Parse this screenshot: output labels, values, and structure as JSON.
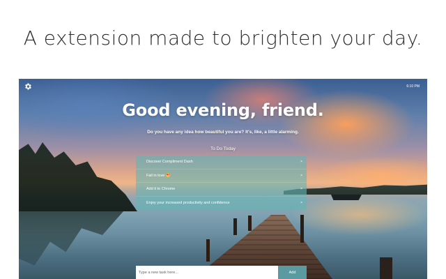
{
  "promo": {
    "headline": "A extension made to brighten your day."
  },
  "app": {
    "settings_icon": "gear-icon",
    "clock": "6:10 PM",
    "greeting": "Good evening, friend.",
    "compliment": "Do you have any idea how beautiful you are? It's, like, a little alarming.",
    "todo_title": "To Do Today",
    "todos": [
      {
        "label": "Discover Compliment Dash",
        "delete": "×"
      },
      {
        "label": "Fall in love",
        "delete": "×",
        "icon": "heart-eyes-emoji"
      },
      {
        "label": "Add it to Chrome",
        "delete": "×"
      },
      {
        "label": "Enjoy your increased productivity and confidence",
        "delete": "×"
      }
    ],
    "new_task_placeholder": "Type a new task here...",
    "add_label": "Add"
  }
}
